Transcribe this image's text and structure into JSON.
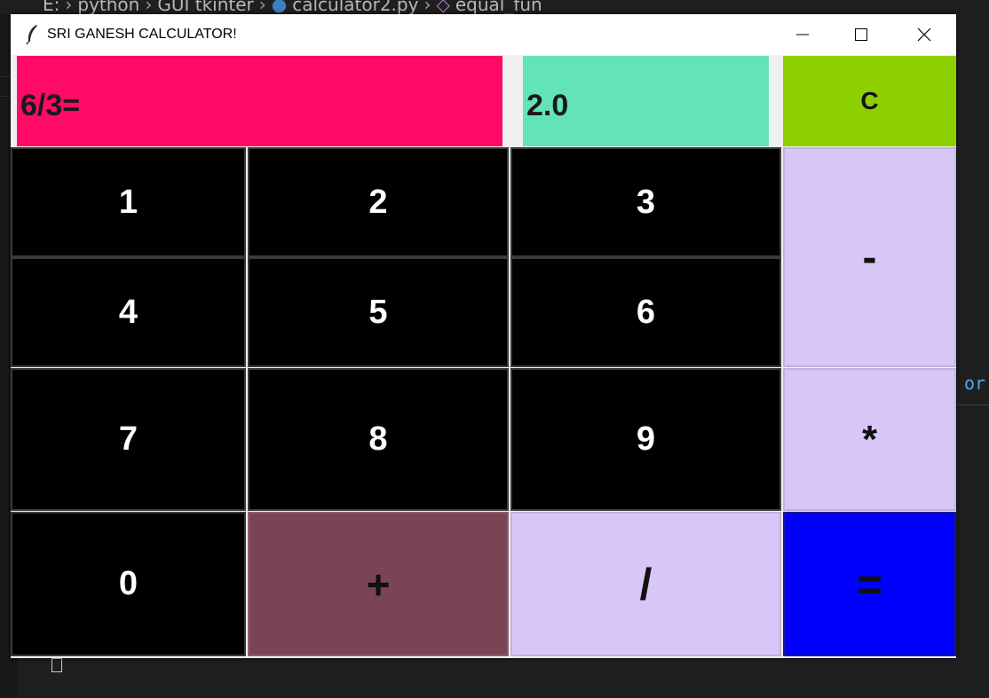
{
  "editor": {
    "breadcrumb": [
      "E:",
      "python",
      "GUI tkinter",
      "calculator2.py",
      "equal_fun"
    ],
    "right_fragment": "or"
  },
  "window": {
    "title": "SRI GANESH CALCULATOR!"
  },
  "display": {
    "expression": "6/3=",
    "result": "2.0"
  },
  "buttons": {
    "clear": "C",
    "one": "1",
    "two": "2",
    "three": "3",
    "four": "4",
    "five": "5",
    "six": "6",
    "seven": "7",
    "eight": "8",
    "nine": "9",
    "zero": "0",
    "minus": "-",
    "multiply": "*",
    "plus": "+",
    "divide": "/",
    "equals": "="
  },
  "colors": {
    "expression_bg": "#ff0a66",
    "result_bg": "#63e4b8",
    "clear_bg": "#8ecf00",
    "operator_bg": "#d8c6f7",
    "plus_bg": "#7a4454",
    "equals_bg": "#0000ff",
    "digit_bg": "#000000"
  }
}
